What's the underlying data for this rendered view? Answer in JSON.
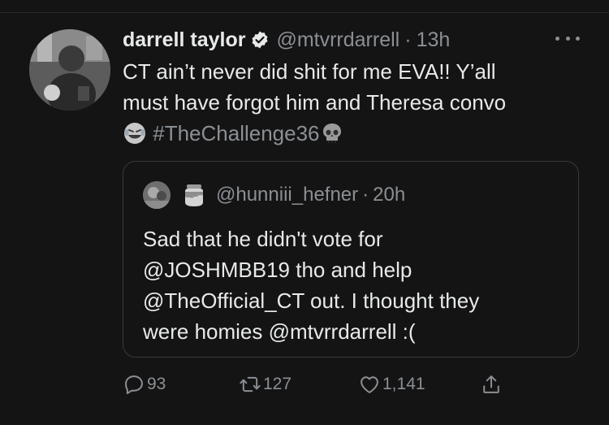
{
  "tweet": {
    "author_name": "darrell taylor",
    "author_handle": "@mtvrrdarrell",
    "separator": "·",
    "time": "13h",
    "text_line1": "CT ain’t never did shit for me EVA!! Y’all",
    "text_line2": "must have forgot him and Theresa convo",
    "hashtag": "#TheChallenge36",
    "emojis": [
      "rolling-on-floor-laughing",
      "skull"
    ]
  },
  "quote": {
    "handle": "@hunniii_hefner",
    "separator": "·",
    "time": "20h",
    "lines": [
      "Sad that he didn't vote for",
      "@JOSHMBB19 tho and help",
      "@TheOfficial_CT out. I thought they",
      "were homies @mtvrrdarrell :("
    ]
  },
  "actions": {
    "replies": "93",
    "retweets": "127",
    "likes": "1,141"
  },
  "colors": {
    "background": "#141414",
    "text": "#e7e9ea",
    "muted": "#8b8f94",
    "border": "#3a3a3a"
  },
  "icons": [
    "verified-badge-icon",
    "more-options-icon",
    "reply-icon",
    "retweet-icon",
    "like-icon",
    "share-icon"
  ]
}
